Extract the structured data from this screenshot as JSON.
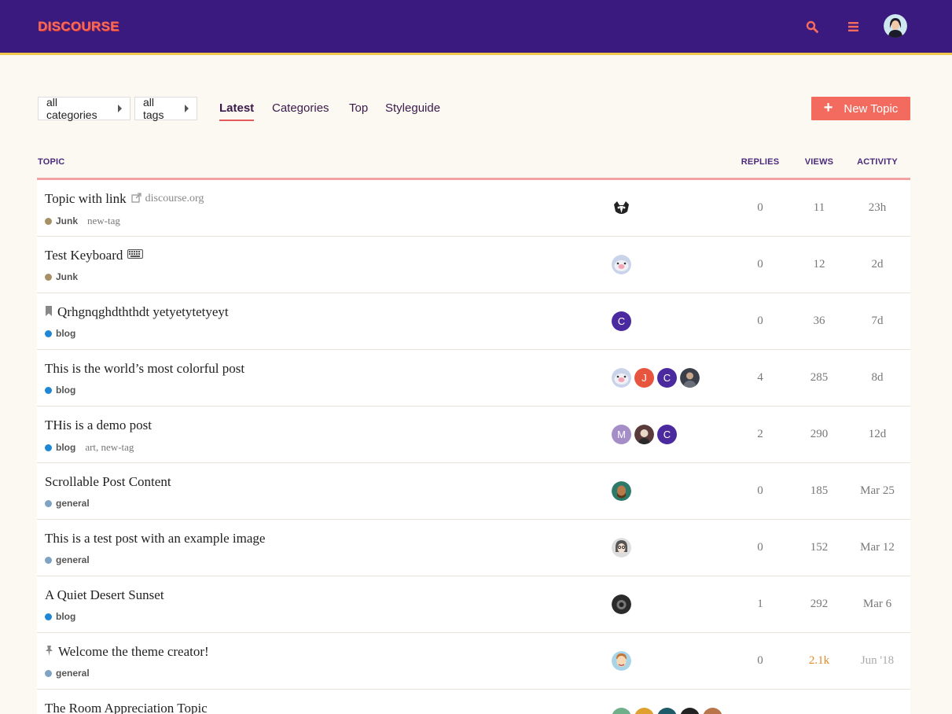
{
  "brand": {
    "logo": "DISCOURSE"
  },
  "nav": {
    "categories_dropdown": "all categories",
    "tags_dropdown": "all tags",
    "links": [
      "Latest",
      "Categories",
      "Top",
      "Styleguide"
    ],
    "active": "Latest",
    "new_topic": "New Topic"
  },
  "table": {
    "headers": {
      "topic": "TOPIC",
      "replies": "REPLIES",
      "views": "VIEWS",
      "activity": "ACTIVITY"
    },
    "rows": [
      {
        "title": "Topic with link",
        "domain": "discourse.org",
        "category": "Junk",
        "tags": "new-tag",
        "replies": "0",
        "views": "11",
        "activity": "23h"
      },
      {
        "title": "Test Keyboard",
        "category": "Junk",
        "tags": "",
        "replies": "0",
        "views": "12",
        "activity": "2d"
      },
      {
        "title": "Qrhgnqghdththdt yetyetytetyeyt",
        "category": "blog",
        "tags": "",
        "replies": "0",
        "views": "36",
        "activity": "7d"
      },
      {
        "title": "This is the world’s most colorful post",
        "category": "blog",
        "tags": "",
        "replies": "4",
        "views": "285",
        "activity": "8d"
      },
      {
        "title": "THis is a demo post",
        "category": "blog",
        "tags": "art, new-tag",
        "replies": "2",
        "views": "290",
        "activity": "12d"
      },
      {
        "title": "Scrollable Post Content",
        "category": "general",
        "tags": "",
        "replies": "0",
        "views": "185",
        "activity": "Mar 25"
      },
      {
        "title": "This is a test post with an example image",
        "category": "general",
        "tags": "",
        "replies": "0",
        "views": "152",
        "activity": "Mar 12"
      },
      {
        "title": "A Quiet Desert Sunset",
        "category": "blog",
        "tags": "",
        "replies": "1",
        "views": "292",
        "activity": "Mar 6"
      },
      {
        "title": "Welcome the theme creator!",
        "category": "general",
        "tags": "",
        "replies": "0",
        "views": "2.1k",
        "activity": "Jun '18"
      },
      {
        "title": "The Room Appreciation Topic",
        "category": "",
        "tags": "",
        "replies": "",
        "views": "",
        "activity": ""
      }
    ]
  },
  "colors": {
    "header_bg": "#3b1a80",
    "accent": "#f26b5e",
    "junk": "#a89066",
    "blog": "#1e88d6",
    "general": "#7ea3c4"
  }
}
